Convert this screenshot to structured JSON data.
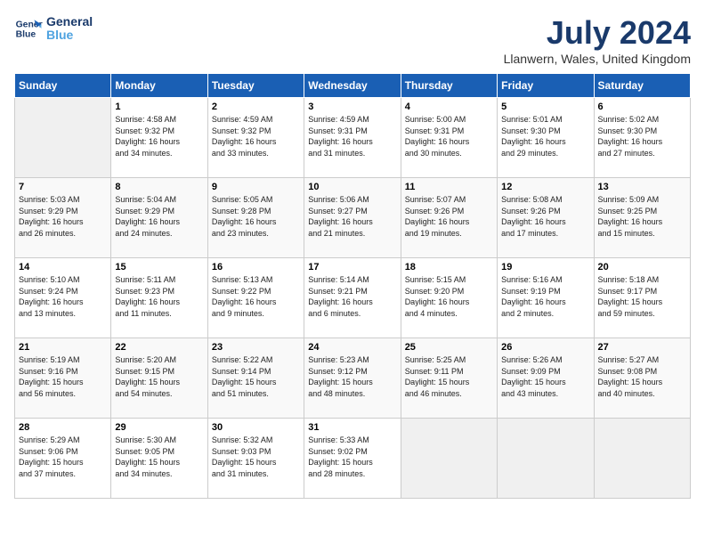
{
  "logo": {
    "line1": "General",
    "line2": "Blue"
  },
  "title": "July 2024",
  "location": "Llanwern, Wales, United Kingdom",
  "weekdays": [
    "Sunday",
    "Monday",
    "Tuesday",
    "Wednesday",
    "Thursday",
    "Friday",
    "Saturday"
  ],
  "weeks": [
    [
      {
        "day": "",
        "info": ""
      },
      {
        "day": "1",
        "info": "Sunrise: 4:58 AM\nSunset: 9:32 PM\nDaylight: 16 hours\nand 34 minutes."
      },
      {
        "day": "2",
        "info": "Sunrise: 4:59 AM\nSunset: 9:32 PM\nDaylight: 16 hours\nand 33 minutes."
      },
      {
        "day": "3",
        "info": "Sunrise: 4:59 AM\nSunset: 9:31 PM\nDaylight: 16 hours\nand 31 minutes."
      },
      {
        "day": "4",
        "info": "Sunrise: 5:00 AM\nSunset: 9:31 PM\nDaylight: 16 hours\nand 30 minutes."
      },
      {
        "day": "5",
        "info": "Sunrise: 5:01 AM\nSunset: 9:30 PM\nDaylight: 16 hours\nand 29 minutes."
      },
      {
        "day": "6",
        "info": "Sunrise: 5:02 AM\nSunset: 9:30 PM\nDaylight: 16 hours\nand 27 minutes."
      }
    ],
    [
      {
        "day": "7",
        "info": "Sunrise: 5:03 AM\nSunset: 9:29 PM\nDaylight: 16 hours\nand 26 minutes."
      },
      {
        "day": "8",
        "info": "Sunrise: 5:04 AM\nSunset: 9:29 PM\nDaylight: 16 hours\nand 24 minutes."
      },
      {
        "day": "9",
        "info": "Sunrise: 5:05 AM\nSunset: 9:28 PM\nDaylight: 16 hours\nand 23 minutes."
      },
      {
        "day": "10",
        "info": "Sunrise: 5:06 AM\nSunset: 9:27 PM\nDaylight: 16 hours\nand 21 minutes."
      },
      {
        "day": "11",
        "info": "Sunrise: 5:07 AM\nSunset: 9:26 PM\nDaylight: 16 hours\nand 19 minutes."
      },
      {
        "day": "12",
        "info": "Sunrise: 5:08 AM\nSunset: 9:26 PM\nDaylight: 16 hours\nand 17 minutes."
      },
      {
        "day": "13",
        "info": "Sunrise: 5:09 AM\nSunset: 9:25 PM\nDaylight: 16 hours\nand 15 minutes."
      }
    ],
    [
      {
        "day": "14",
        "info": "Sunrise: 5:10 AM\nSunset: 9:24 PM\nDaylight: 16 hours\nand 13 minutes."
      },
      {
        "day": "15",
        "info": "Sunrise: 5:11 AM\nSunset: 9:23 PM\nDaylight: 16 hours\nand 11 minutes."
      },
      {
        "day": "16",
        "info": "Sunrise: 5:13 AM\nSunset: 9:22 PM\nDaylight: 16 hours\nand 9 minutes."
      },
      {
        "day": "17",
        "info": "Sunrise: 5:14 AM\nSunset: 9:21 PM\nDaylight: 16 hours\nand 6 minutes."
      },
      {
        "day": "18",
        "info": "Sunrise: 5:15 AM\nSunset: 9:20 PM\nDaylight: 16 hours\nand 4 minutes."
      },
      {
        "day": "19",
        "info": "Sunrise: 5:16 AM\nSunset: 9:19 PM\nDaylight: 16 hours\nand 2 minutes."
      },
      {
        "day": "20",
        "info": "Sunrise: 5:18 AM\nSunset: 9:17 PM\nDaylight: 15 hours\nand 59 minutes."
      }
    ],
    [
      {
        "day": "21",
        "info": "Sunrise: 5:19 AM\nSunset: 9:16 PM\nDaylight: 15 hours\nand 56 minutes."
      },
      {
        "day": "22",
        "info": "Sunrise: 5:20 AM\nSunset: 9:15 PM\nDaylight: 15 hours\nand 54 minutes."
      },
      {
        "day": "23",
        "info": "Sunrise: 5:22 AM\nSunset: 9:14 PM\nDaylight: 15 hours\nand 51 minutes."
      },
      {
        "day": "24",
        "info": "Sunrise: 5:23 AM\nSunset: 9:12 PM\nDaylight: 15 hours\nand 48 minutes."
      },
      {
        "day": "25",
        "info": "Sunrise: 5:25 AM\nSunset: 9:11 PM\nDaylight: 15 hours\nand 46 minutes."
      },
      {
        "day": "26",
        "info": "Sunrise: 5:26 AM\nSunset: 9:09 PM\nDaylight: 15 hours\nand 43 minutes."
      },
      {
        "day": "27",
        "info": "Sunrise: 5:27 AM\nSunset: 9:08 PM\nDaylight: 15 hours\nand 40 minutes."
      }
    ],
    [
      {
        "day": "28",
        "info": "Sunrise: 5:29 AM\nSunset: 9:06 PM\nDaylight: 15 hours\nand 37 minutes."
      },
      {
        "day": "29",
        "info": "Sunrise: 5:30 AM\nSunset: 9:05 PM\nDaylight: 15 hours\nand 34 minutes."
      },
      {
        "day": "30",
        "info": "Sunrise: 5:32 AM\nSunset: 9:03 PM\nDaylight: 15 hours\nand 31 minutes."
      },
      {
        "day": "31",
        "info": "Sunrise: 5:33 AM\nSunset: 9:02 PM\nDaylight: 15 hours\nand 28 minutes."
      },
      {
        "day": "",
        "info": ""
      },
      {
        "day": "",
        "info": ""
      },
      {
        "day": "",
        "info": ""
      }
    ]
  ]
}
